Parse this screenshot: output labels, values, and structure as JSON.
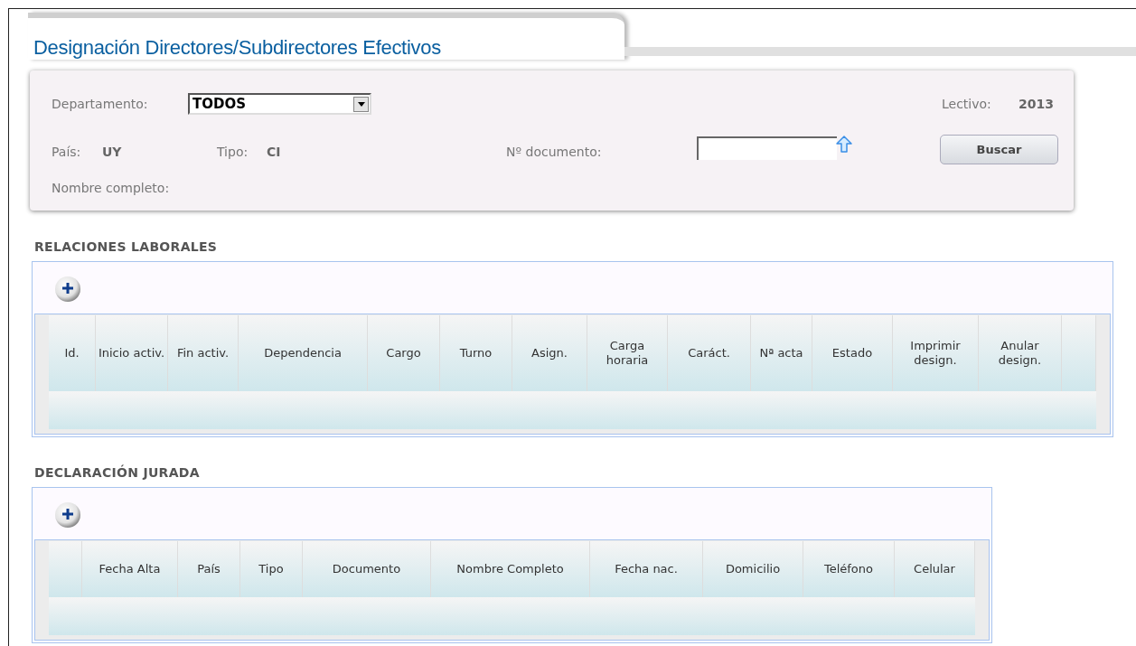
{
  "page_title": "Designación Directores/Subdirectores Efectivos",
  "filters": {
    "departamento_label": "Departamento:",
    "departamento_value": "TODOS",
    "lectivo_label": "Lectivo:",
    "lectivo_value": "2013",
    "pais_label": "País:",
    "pais_value": "UY",
    "tipo_label": "Tipo:",
    "tipo_value": "CI",
    "documento_label": "Nº documento:",
    "nombre_label": "Nombre completo:",
    "search_button": "Buscar"
  },
  "sections": [
    {
      "title": "RELACIONES LABORALES",
      "columns": [
        "Id.",
        "Inicio activ.",
        "Fin activ.",
        "Dependencia",
        "Cargo",
        "Turno",
        "Asign.",
        "Carga horaria",
        "Caráct.",
        "Nª acta",
        "Estado",
        "Imprimir design.",
        "Anular design."
      ]
    },
    {
      "title": "DECLARACIÓN JURADA",
      "columns": [
        "Fecha Alta",
        "País",
        "Tipo",
        "Documento",
        "Nombre Completo",
        "Fecha nac.",
        "Domicilio",
        "Teléfono",
        "Celular"
      ]
    }
  ]
}
